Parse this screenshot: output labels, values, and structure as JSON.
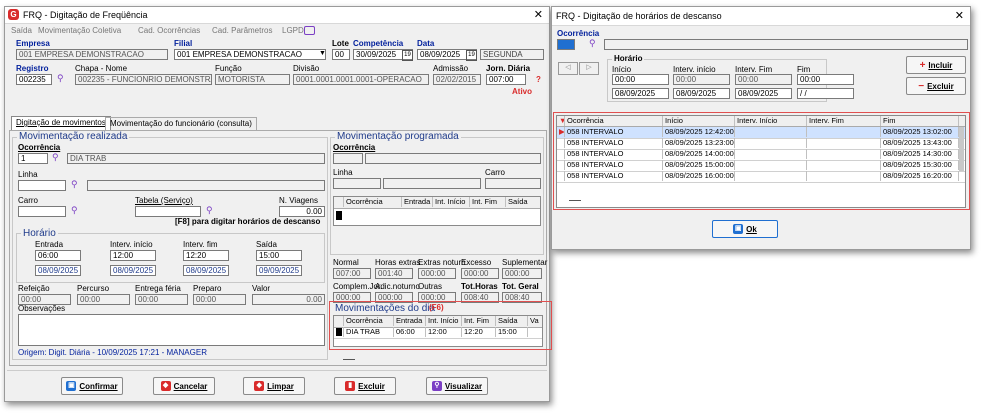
{
  "left_window": {
    "title": "FRQ - Digitação de Freqüência",
    "menu": [
      "Saída",
      "Movimentação Coletiva",
      "Cad. Ocorrências",
      "Cad. Parâmetros",
      "LGPD"
    ],
    "header": {
      "empresa_label": "Empresa",
      "empresa_value": "001 EMPRESA DEMONSTRACAO",
      "filial_label": "Filial",
      "filial_value": "001 EMPRESA DEMONSTRACAO",
      "lote_label": "Lote",
      "lote_value": "00",
      "competencia_label": "Competência",
      "competencia_value": "30/09/2025",
      "data_label": "Data",
      "data_value": "08/09/2025",
      "weekday": "SEGUNDA",
      "registro_label": "Registro",
      "registro_value": "002235",
      "chapa_label": "Chapa - Nome",
      "chapa_value": "002235 - FUNCIONRIO DEMONSTRACA",
      "funcao_label": "Função",
      "funcao_value": "MOTORISTA",
      "divisao_label": "Divisão",
      "divisao_value": "0001.0001.0001.0001-OPERACAO",
      "admissao_label": "Admissão",
      "admissao_value": "02/02/2015",
      "jornada_label": "Jorn. Diária",
      "jornada_value": "007:00",
      "status": "Ativo",
      "help": "?"
    },
    "tabs": [
      "Digitação de movimentos",
      "Movimentação do funcionário (consulta)"
    ],
    "realizada": {
      "title": "Movimentação realizada",
      "ocorrencia_label": "Ocorrência",
      "ocorrencia_code": "1",
      "ocorrencia_desc": "DIA TRAB",
      "linha_label": "Linha",
      "carro_label": "Carro",
      "tabela_label": "Tabela (Serviço)",
      "viagens_label": "N. Viagens",
      "viagens_value": "0.00",
      "f8_hint": "[F8] para digitar horários de descanso"
    },
    "horario": {
      "title": "Horário",
      "cols": [
        {
          "label": "Entrada",
          "time": "06:00",
          "date": "08/09/2025"
        },
        {
          "label": "Interv. início",
          "time": "12:00",
          "date": "08/09/2025"
        },
        {
          "label": "Interv. fim",
          "time": "12:20",
          "date": "08/09/2025"
        },
        {
          "label": "Saída",
          "time": "15:00",
          "date": "09/09/2025"
        }
      ]
    },
    "extras": [
      {
        "label": "Refeição",
        "value": "00:00"
      },
      {
        "label": "Percurso",
        "value": "00:00"
      },
      {
        "label": "Entrega féria",
        "value": "00:00"
      },
      {
        "label": "Preparo",
        "value": "00:00"
      },
      {
        "label": "Valor",
        "value": "0.00"
      }
    ],
    "observacoes_label": "Observações",
    "origem": "Origem: Digit. Diária - 10/09/2025 17:21 - MANAGER",
    "programada": {
      "title": "Movimentação programada",
      "ocorrencia_label": "Ocorrência",
      "linha_label": "Linha",
      "carro_label": "Carro",
      "grid_cols": [
        "Ocorrência",
        "Entrada",
        "Int. Início",
        "Int. Fim",
        "Saída"
      ]
    },
    "totals": {
      "row1": [
        {
          "label": "Normal",
          "value": "007:00"
        },
        {
          "label": "Horas extras",
          "value": "001:40"
        },
        {
          "label": "Extras noturn.",
          "value": "000:00"
        },
        {
          "label": "Excesso",
          "value": "000:00"
        },
        {
          "label": "Suplementar",
          "value": "000:00"
        }
      ],
      "row2": [
        {
          "label": "Complem.Jor.",
          "value": "000:00"
        },
        {
          "label": "Adic.noturno",
          "value": "000:00"
        },
        {
          "label": "Outras",
          "value": "000:00"
        },
        {
          "label": "Tot.Horas",
          "value": "008:40"
        },
        {
          "label": "Tot. Geral",
          "value": "008:40"
        }
      ]
    },
    "movdia": {
      "title": "Movimentações do dia",
      "key": "(F6)",
      "cols": [
        "Ocorrência",
        "Entrada",
        "Int. Início",
        "Int. Fim",
        "Saída",
        "Va"
      ],
      "row": [
        "DIA TRAB",
        "06:00",
        "12:00",
        "12:20",
        "15:00",
        ""
      ]
    },
    "buttons": [
      "Confirmar",
      "Cancelar",
      "Limpar",
      "Excluir",
      "Visualizar"
    ]
  },
  "right_window": {
    "title": "FRQ - Digitação de horários de descanso",
    "ocorrencia_label": "Ocorrência",
    "horario_title": "Horário",
    "labels": [
      "Início",
      "Interv. início",
      "Interv. Fim",
      "Fim"
    ],
    "times": [
      "00:00",
      "00:00",
      "00:00",
      "00:00"
    ],
    "dates": [
      "08/09/2025",
      "08/09/2025",
      "08/09/2025",
      "  /  /"
    ],
    "incluir": "Incluir",
    "excluir": "Excluir",
    "grid_cols": [
      "Ocorrência",
      "Início",
      "Interv. Início",
      "Interv. Fim",
      "Fim"
    ],
    "rows": [
      [
        "058 INTERVALO",
        "08/09/2025 12:42:00",
        "",
        "",
        "08/09/2025 13:02:00"
      ],
      [
        "058 INTERVALO",
        "08/09/2025 13:23:00",
        "",
        "",
        "08/09/2025 13:43:00"
      ],
      [
        "058 INTERVALO",
        "08/09/2025 14:00:00",
        "",
        "",
        "08/09/2025 14:30:00"
      ],
      [
        "058 INTERVALO",
        "08/09/2025 15:00:00",
        "",
        "",
        "08/09/2025 15:30:00"
      ],
      [
        "058 INTERVALO",
        "08/09/2025 16:00:00",
        "",
        "",
        "08/09/2025 16:20:00"
      ]
    ],
    "ok": "Ok"
  },
  "colors": {
    "accent": "#0a5fc8",
    "highlight": "#cfe2ff",
    "brand": "#d92b2b",
    "alert": "#e05050"
  }
}
